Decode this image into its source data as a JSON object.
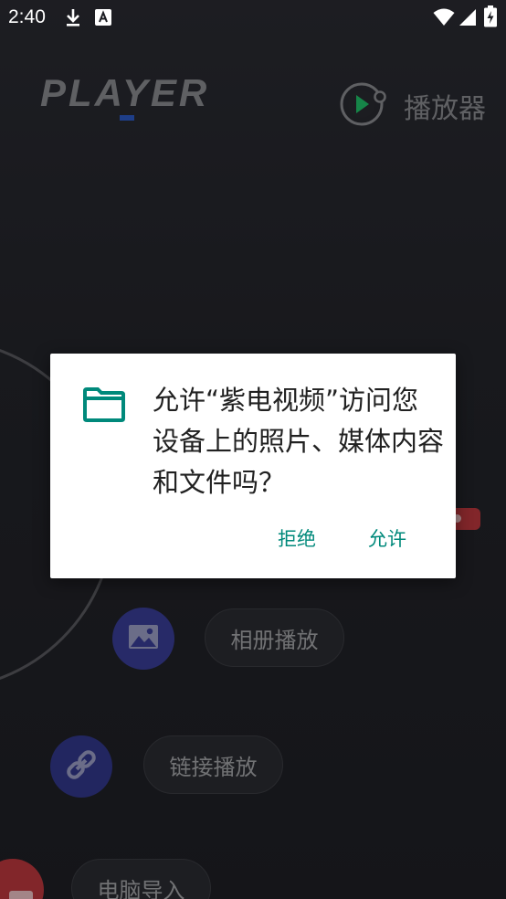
{
  "status_bar": {
    "time": "2:40",
    "icons": [
      "download-icon",
      "a-notification-icon",
      "wifi-icon",
      "cellular-signal-icon",
      "battery-charging-icon"
    ]
  },
  "header": {
    "logo_text": "PLAYER",
    "player_label": "播放器"
  },
  "menu": {
    "album_label": "相册播放",
    "link_label": "链接播放",
    "pc_import_label": "电脑导入"
  },
  "dialog": {
    "message": "允许“紫电视频”访问您设备上的照片、媒体内容和文件吗？",
    "deny_label": "拒绝",
    "allow_label": "允许",
    "icon": "folder-icon"
  },
  "colors": {
    "accent_teal": "#00897b",
    "logo_blue": "#2d5cc9",
    "album_circle": "#3a3f9a",
    "link_circle": "#33398e",
    "pc_circle": "#c0393f",
    "player_green": "#21c46a"
  }
}
